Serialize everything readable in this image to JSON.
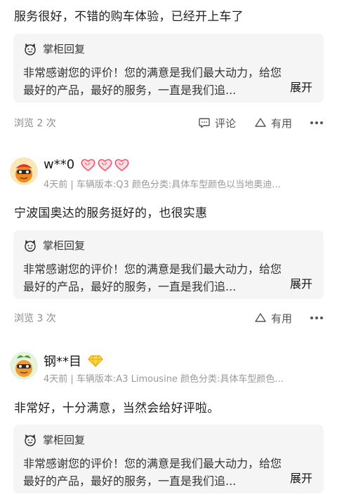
{
  "reviews": [
    {
      "text": "服务很好，不错的购车体验，已经开上车了",
      "reply": {
        "title": "掌柜回复",
        "line1": "非常感谢您的评价！您的满意是我们最大动力，给您",
        "line2": "最好的产品，最好的服务，一直是我们追...",
        "expand": "展开"
      },
      "views": "浏览 2 次",
      "comment_label": "评论",
      "useful_label": "有用"
    },
    {
      "username": "w**0",
      "badge_type": "hearts",
      "meta": "4天前 | 车辆版本:Q3 颜色分类:具体车型颜色以当地奥迪...",
      "text": "宁波国奥达的服务挺好的，也很实惠",
      "reply": {
        "title": "掌柜回复",
        "line1": "非常感谢您的评价！您的满意是我们最大动力，给您",
        "line2": "最好的产品，最好的服务，一直是我们追...",
        "expand": "展开"
      },
      "views": "浏览 3 次",
      "useful_label": "有用"
    },
    {
      "username": "钢**目",
      "badge_type": "diamond",
      "meta": "4天前 | 车辆版本:A3 Limousine 颜色分类:具体车型颜色...",
      "text": "非常好，十分满意，当然会给好评啦。",
      "reply": {
        "title": "掌柜回复",
        "line1": "非常感谢您的评价！您的满意是我们最大动力，给您",
        "line2": "最好的产品，最好的服务，一直是我们追...",
        "expand": "展开"
      }
    }
  ],
  "colors": {
    "reply_bg": "#f5f5f5",
    "heart_badge": "#f05a72",
    "diamond_badge": "#f5c518"
  }
}
